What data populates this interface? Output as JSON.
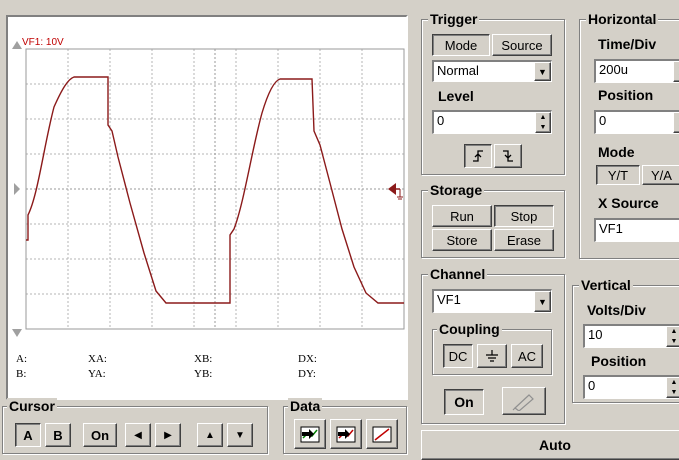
{
  "scope": {
    "channel_label": "VF1: 10V",
    "measurements": {
      "a": "A:",
      "b": "B:",
      "xa": "XA:",
      "ya": "YA:",
      "xb": "XB:",
      "yb": "YB:",
      "dx": "DX:",
      "dy": "DY:"
    }
  },
  "trigger": {
    "title": "Trigger",
    "mode_tab": "Mode",
    "source_tab": "Source",
    "mode_value": "Normal",
    "level_label": "Level",
    "level_value": "0",
    "rising_edge_icon": "rising-edge-icon",
    "falling_edge_icon": "falling-edge-icon"
  },
  "horizontal": {
    "title": "Horizontal",
    "time_div_label": "Time/Div",
    "time_div_value": "200u",
    "position_label": "Position",
    "position_value": "0",
    "mode_label": "Mode",
    "mode_yt": "Y/T",
    "mode_ya": "Y/A",
    "x_source_label": "X Source",
    "x_source_value": "VF1"
  },
  "storage": {
    "title": "Storage",
    "run": "Run",
    "stop": "Stop",
    "store": "Store",
    "erase": "Erase"
  },
  "channel": {
    "title": "Channel",
    "value": "VF1",
    "coupling_label": "Coupling",
    "dc": "DC",
    "ac": "AC",
    "on": "On"
  },
  "vertical": {
    "title": "Vertical",
    "volts_div_label": "Volts/Div",
    "volts_div_value": "10",
    "position_label": "Position",
    "position_value": "0"
  },
  "cursor": {
    "title": "Cursor",
    "a": "A",
    "b": "B",
    "on": "On"
  },
  "data": {
    "title": "Data"
  },
  "auto": {
    "label": "Auto"
  },
  "colors": {
    "trace": "#8b1a1a",
    "grid": "#b0b0b0",
    "label": "#c00000"
  }
}
